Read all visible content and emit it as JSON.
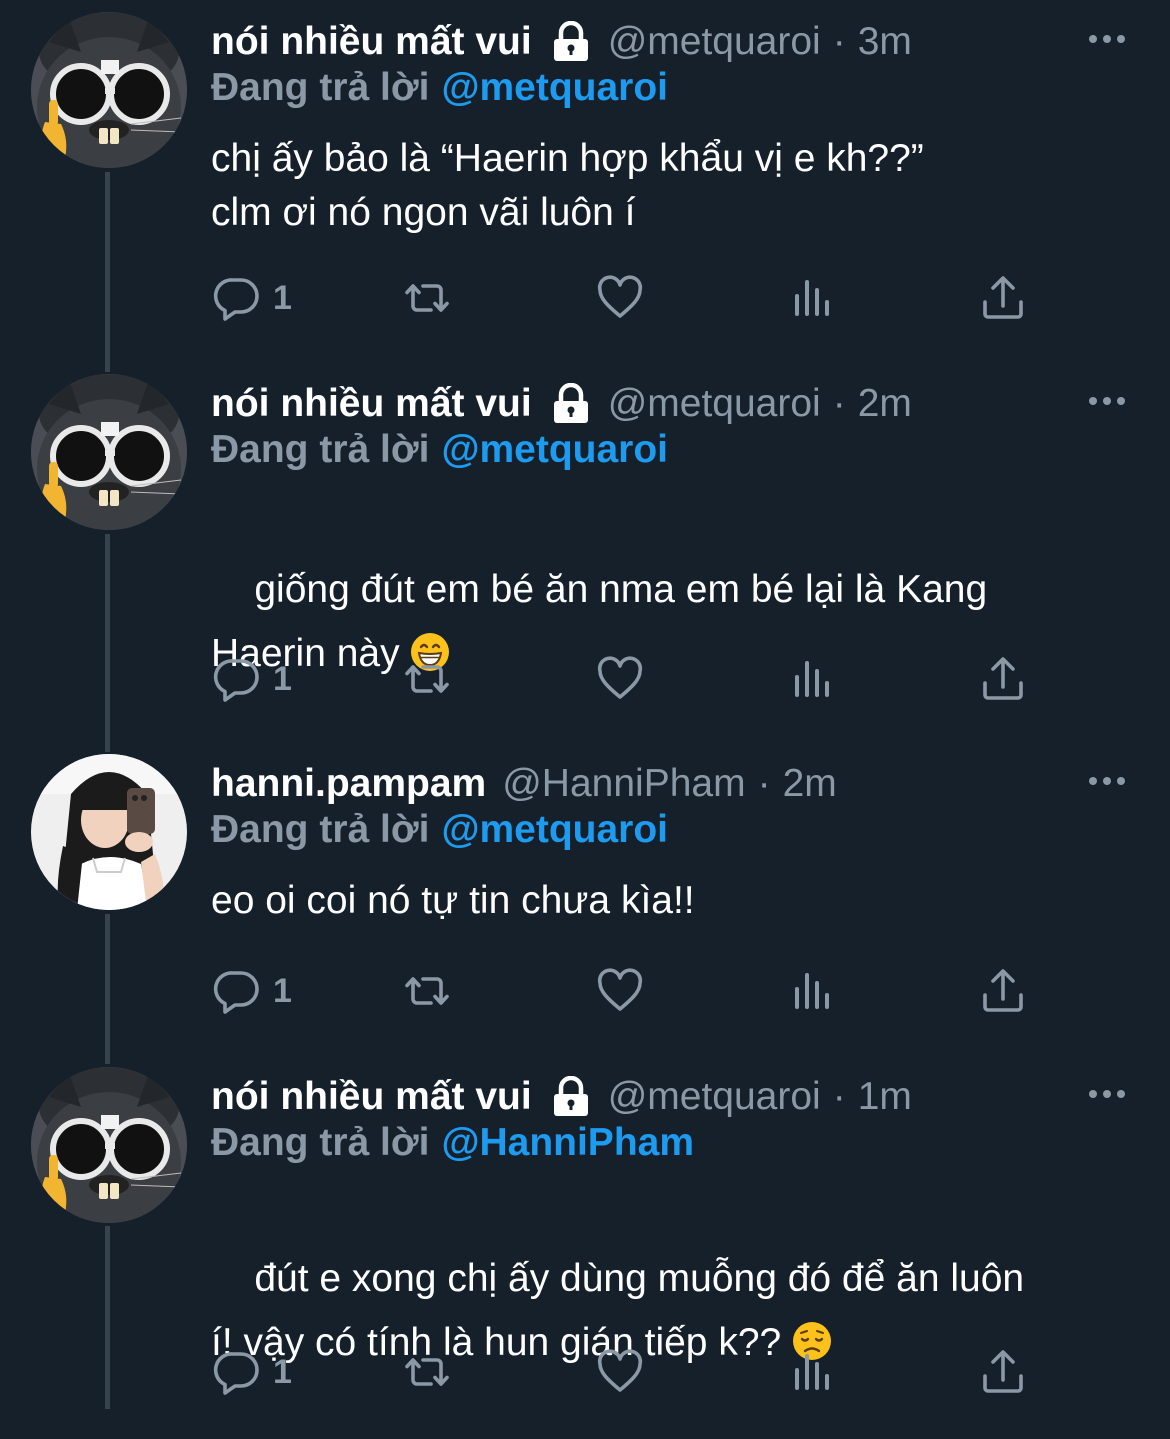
{
  "reply_prefix": "Đang trả lời",
  "tweets": [
    {
      "display_name": "nói nhiều mất vui",
      "handle": "@metquaroi",
      "separator": "·",
      "time": "3m",
      "reply_to": "@metquaroi",
      "text": "chị ấy bảo là “Haerin hợp khẩu vị e kh??”\nclm ơi nó ngon vãi luôn í",
      "reply_count": "1",
      "locked": true,
      "avatar": "cat-with-glasses"
    },
    {
      "display_name": "nói nhiều mất vui",
      "handle": "@metquaroi",
      "separator": "·",
      "time": "2m",
      "reply_to": "@metquaroi",
      "text_before_emoji": "giống đút em bé ăn nma em bé lại là Kang\nHaerin này ",
      "emoji": "grinning-face",
      "reply_count": "1",
      "locked": true,
      "avatar": "cat-with-glasses"
    },
    {
      "display_name": "hanni.pampam",
      "handle": "@HanniPham",
      "separator": "·",
      "time": "2m",
      "reply_to": "@metquaroi",
      "text": "eo oi coi nó tự tin chưa kìa!!",
      "reply_count": "1",
      "locked": false,
      "avatar": "girl-mirror-selfie"
    },
    {
      "display_name": "nói nhiều mất vui",
      "handle": "@metquaroi",
      "separator": "·",
      "time": "1m",
      "reply_to": "@HanniPham",
      "text_before_emoji": "đút e xong chị ấy dùng muỗng đó để ăn luôn\ní! vậy có tính là hun gián tiếp k?? ",
      "emoji": "disappointed-face",
      "reply_count": "1",
      "locked": true,
      "avatar": "cat-with-glasses"
    }
  ],
  "colors": {
    "background": "#15202b",
    "text": "#ffffff",
    "secondary": "#8b98a5",
    "accent": "#1d9bf0",
    "thread_line": "#38444d"
  }
}
